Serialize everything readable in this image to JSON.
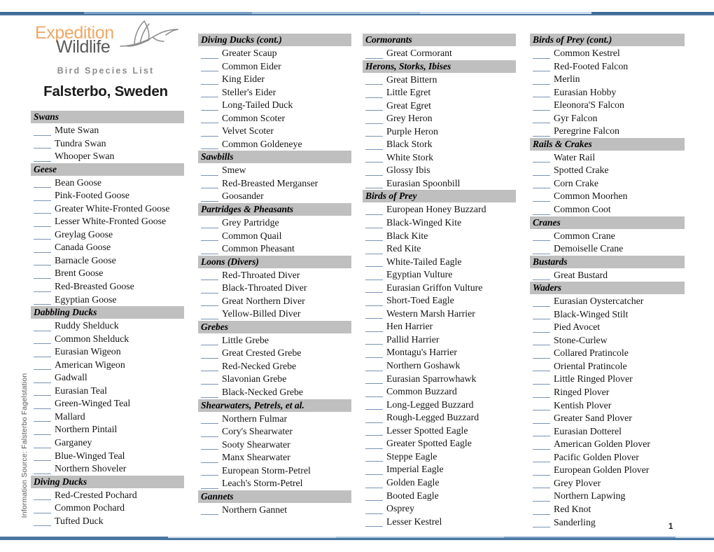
{
  "document": {
    "brand_line_1": "Expedition",
    "brand_line_2": "Wildlife",
    "subtitle": "Bird Species List",
    "title": "Falsterbo, Sweden",
    "side_note": "Information Source: Falsterbo Fagelstation",
    "page_number": "1",
    "colors": {
      "brand_orange": "#f0a868",
      "brand_gray": "#5a5a5a",
      "group_header_bg": "#bfbfbf",
      "blank_line": "#7a93b5",
      "rule_dark": "#3f6b96",
      "rule_mid": "#7ba0c4",
      "rule_light": "#cfdded"
    }
  },
  "columns": [
    {
      "id": "column-1",
      "groups": [
        {
          "header": "Swans",
          "species": [
            "Mute Swan",
            "Tundra Swan",
            "Whooper Swan"
          ]
        },
        {
          "header": "Geese",
          "species": [
            "Bean Goose",
            "Pink-Footed Goose",
            "Greater White-Fronted Goose",
            "Lesser White-Fronted Goose",
            "Greylag Goose",
            "Canada Goose",
            "Barnacle Goose",
            "Brent Goose",
            "Red-Breasted Goose",
            "Egyptian Goose"
          ]
        },
        {
          "header": "Dabbling Ducks",
          "species": [
            "Ruddy Shelduck",
            "Common Shelduck",
            "Eurasian Wigeon",
            "American Wigeon",
            "Gadwall",
            "Eurasian Teal",
            "Green-Winged Teal",
            "Mallard",
            "Northern Pintail",
            "Garganey",
            "Blue-Winged Teal",
            "Northern Shoveler"
          ]
        },
        {
          "header": "Diving Ducks",
          "species": [
            "Red-Crested Pochard",
            "Common Pochard",
            "Tufted Duck"
          ]
        }
      ]
    },
    {
      "id": "column-2",
      "groups": [
        {
          "header": "Diving Ducks (cont.)",
          "species": [
            "Greater Scaup",
            "Common Eider",
            "King Eider",
            "Steller's Eider",
            "Long-Tailed Duck",
            "Common Scoter",
            "Velvet Scoter",
            "Common Goldeneye"
          ]
        },
        {
          "header": "Sawbills",
          "species": [
            "Smew",
            "Red-Breasted Merganser",
            "Goosander"
          ]
        },
        {
          "header": "Partridges & Pheasants",
          "species": [
            "Grey Partridge",
            "Common Quail",
            "Common Pheasant"
          ]
        },
        {
          "header": "Loons (Divers)",
          "species": [
            "Red-Throated Diver",
            "Black-Throated Diver",
            "Great Northern Diver",
            "Yellow-Billed Diver"
          ]
        },
        {
          "header": "Grebes",
          "species": [
            "Little Grebe",
            "Great Crested Grebe",
            "Red-Necked Grebe",
            "Slavonian Grebe",
            "Black-Necked Grebe"
          ]
        },
        {
          "header": "Shearwaters, Petrels, et al.",
          "species": [
            "Northern Fulmar",
            "Cory's Shearwater",
            "Sooty Shearwater",
            "Manx Shearwater",
            "European Storm-Petrel",
            "Leach's Storm-Petrel"
          ]
        },
        {
          "header": "Gannets",
          "species": [
            "Northern Gannet"
          ]
        }
      ]
    },
    {
      "id": "column-3",
      "groups": [
        {
          "header": "Cormorants",
          "species": [
            "Great Cormorant"
          ]
        },
        {
          "header": "Herons, Storks, Ibises",
          "species": [
            "Great Bittern",
            "Little Egret",
            "Great Egret",
            "Grey Heron",
            "Purple Heron",
            "Black Stork",
            "White Stork",
            "Glossy Ibis",
            "Eurasian Spoonbill"
          ]
        },
        {
          "header": "Birds of Prey",
          "species": [
            "European Honey Buzzard",
            "Black-Winged Kite",
            "Black Kite",
            "Red Kite",
            "White-Tailed Eagle",
            "Egyptian Vulture",
            "Eurasian Griffon Vulture",
            "Short-Toed Eagle",
            "Western Marsh Harrier",
            "Hen Harrier",
            "Pallid Harrier",
            "Montagu's Harrier",
            "Northern Goshawk",
            "Eurasian Sparrowhawk",
            "Common Buzzard",
            "Long-Legged Buzzard",
            "Rough-Legged Buzzard",
            "Lesser Spotted Eagle",
            "Greater Spotted Eagle",
            "Steppe Eagle",
            "Imperial Eagle",
            "Golden Eagle",
            "Booted Eagle",
            "Osprey",
            "Lesser Kestrel"
          ]
        }
      ]
    },
    {
      "id": "column-4",
      "groups": [
        {
          "header": "Birds of Prey (cont.)",
          "species": [
            "Common Kestrel",
            "Red-Footed Falcon",
            "Merlin",
            "Eurasian Hobby",
            "Eleonora'S Falcon",
            "Gyr Falcon",
            "Peregrine Falcon"
          ]
        },
        {
          "header": "Rails & Crakes",
          "species": [
            "Water Rail",
            "Spotted Crake",
            "Corn Crake",
            "Common Moorhen",
            "Common Coot"
          ]
        },
        {
          "header": "Cranes",
          "species": [
            "Common Crane",
            "Demoiselle Crane"
          ]
        },
        {
          "header": "Bustards",
          "species": [
            "Great Bustard"
          ]
        },
        {
          "header": "Waders",
          "species": [
            "Eurasian Oystercatcher",
            "Black-Winged Stilt",
            "Pied Avocet",
            "Stone-Curlew",
            "Collared Pratincole",
            "Oriental Pratincole",
            "Little Ringed Plover",
            "Ringed Plover",
            "Kentish Plover",
            "Greater Sand Plover",
            "Eurasian Dotterel",
            "American Golden Plover",
            "Pacific Golden Plover",
            "European Golden Plover",
            "Grey Plover",
            "Northern Lapwing",
            "Red Knot",
            "Sanderling"
          ]
        }
      ]
    }
  ]
}
